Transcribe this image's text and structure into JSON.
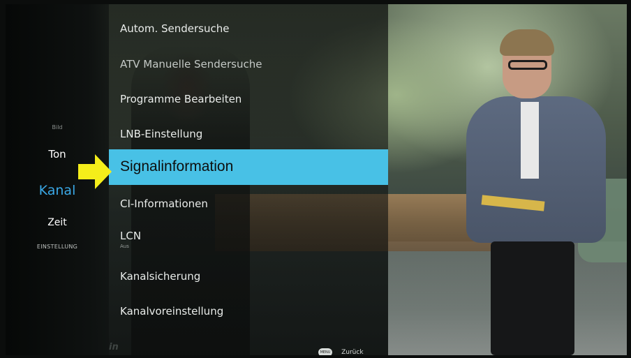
{
  "categories": {
    "faint_top": "",
    "bild": "Bild",
    "ton": "Ton",
    "kanal": "Kanal",
    "zeit": "Zeit",
    "einstellung": "EINSTELLUNG",
    "faint_bottom": ""
  },
  "menu": {
    "items": [
      {
        "label": "Autom. Sendersuche"
      },
      {
        "label": "ATV Manuelle Sendersuche"
      },
      {
        "label": "Programme Bearbeiten"
      },
      {
        "label": "LNB-Einstellung"
      },
      {
        "label": "Signalinformation",
        "selected": true
      },
      {
        "label": "CI-Informationen"
      },
      {
        "label": "LCN",
        "value": "Aus"
      },
      {
        "label": "Kanalsicherung"
      },
      {
        "label": "Kanalvoreinstellung"
      }
    ]
  },
  "footer": {
    "logo": "in",
    "menu_key": "MENU",
    "back_label": "Zurück"
  },
  "colors": {
    "highlight": "#48c1e6",
    "active_category": "#3aa8e6",
    "arrow": "#f5ee1a"
  },
  "icons": {
    "pointer": "yellow-arrow-icon",
    "menu_key": "menu-button-icon"
  }
}
